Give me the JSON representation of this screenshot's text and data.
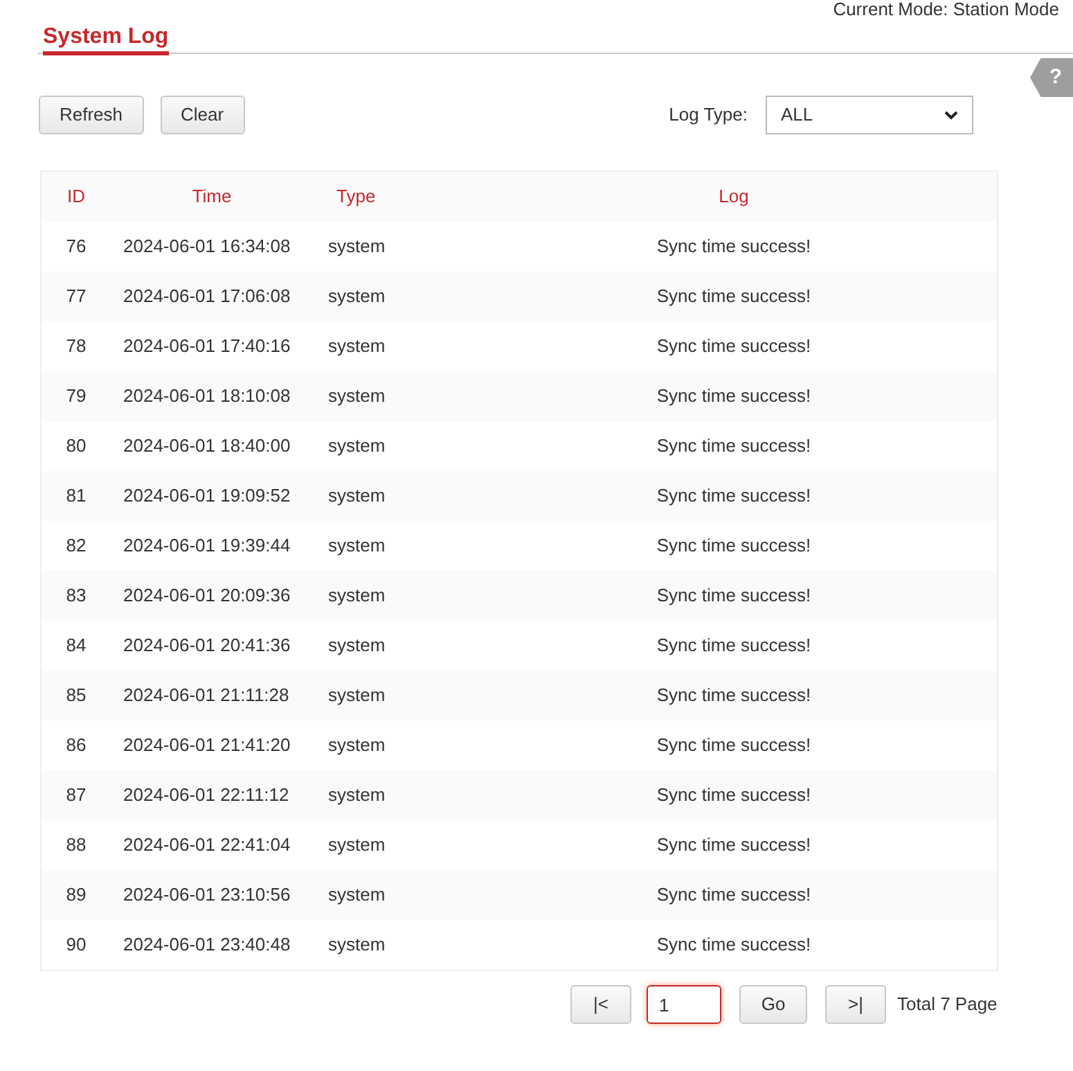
{
  "mode_label": "Current Mode: Station Mode",
  "title": "System Log",
  "help": {
    "label": "?"
  },
  "buttons": [
    "Refresh",
    "Clear"
  ],
  "log_type": {
    "label": "Log Type:",
    "value": "ALL"
  },
  "table": {
    "columns": [
      "ID",
      "Time",
      "Type",
      "Log"
    ],
    "rows": [
      [
        "76",
        "2024-06-01 16:34:08",
        "system",
        "Sync time success!"
      ],
      [
        "77",
        "2024-06-01 17:06:08",
        "system",
        "Sync time success!"
      ],
      [
        "78",
        "2024-06-01 17:40:16",
        "system",
        "Sync time success!"
      ],
      [
        "79",
        "2024-06-01 18:10:08",
        "system",
        "Sync time success!"
      ],
      [
        "80",
        "2024-06-01 18:40:00",
        "system",
        "Sync time success!"
      ],
      [
        "81",
        "2024-06-01 19:09:52",
        "system",
        "Sync time success!"
      ],
      [
        "82",
        "2024-06-01 19:39:44",
        "system",
        "Sync time success!"
      ],
      [
        "83",
        "2024-06-01 20:09:36",
        "system",
        "Sync time success!"
      ],
      [
        "84",
        "2024-06-01 20:41:36",
        "system",
        "Sync time success!"
      ],
      [
        "85",
        "2024-06-01 21:11:28",
        "system",
        "Sync time success!"
      ],
      [
        "86",
        "2024-06-01 21:41:20",
        "system",
        "Sync time success!"
      ],
      [
        "87",
        "2024-06-01 22:11:12",
        "system",
        "Sync time success!"
      ],
      [
        "88",
        "2024-06-01 22:41:04",
        "system",
        "Sync time success!"
      ],
      [
        "89",
        "2024-06-01 23:10:56",
        "system",
        "Sync time success!"
      ],
      [
        "90",
        "2024-06-01 23:40:48",
        "system",
        "Sync time success!"
      ]
    ]
  },
  "pager": {
    "first": "|<",
    "page": "1",
    "go": "Go",
    "last": ">|",
    "total": "Total 7 Page"
  }
}
